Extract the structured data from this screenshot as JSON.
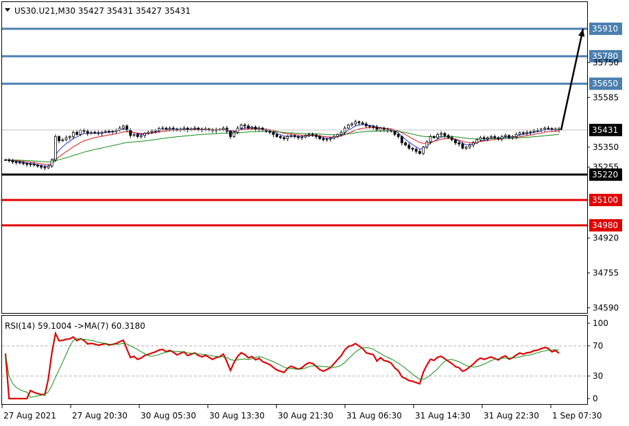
{
  "header": {
    "symbol_line": "US30.U21,M30  35427 35431 35427 35431",
    "dropdown_icon": "triangle-down-icon"
  },
  "chart_data": [
    {
      "type": "candlestick",
      "symbol": "US30.U21",
      "timeframe": "M30",
      "ohlc_last": [
        35427,
        35431,
        35427,
        35431
      ],
      "price_ticks": [
        35750,
        35585,
        35350,
        35255,
        34920,
        34755,
        34590
      ],
      "ylim": [
        34550,
        36020
      ],
      "current_price": 35431,
      "x_tick_labels": [
        "27 Aug 2021",
        "27 Aug 20:30",
        "30 Aug 05:30",
        "30 Aug 13:30",
        "30 Aug 21:30",
        "31 Aug 06:30",
        "31 Aug 14:30",
        "31 Aug 22:30",
        "1 Sep 07:30"
      ],
      "levels": [
        {
          "value": 35910,
          "label": "35910",
          "color": "#4a7fb0"
        },
        {
          "value": 35780,
          "label": "35780",
          "color": "#4a7fb0"
        },
        {
          "value": 35650,
          "label": "35650",
          "color": "#4a7fb0"
        },
        {
          "value": 35220,
          "label": "35220",
          "color": "#000000"
        },
        {
          "value": 35100,
          "label": "35100",
          "color": "#e00000"
        },
        {
          "value": 34980,
          "label": "34980",
          "color": "#e00000"
        }
      ],
      "current_price_label": "35431",
      "arrow": {
        "from_price": 35431,
        "to_price": 35910
      },
      "closes": [
        35290,
        35285,
        35280,
        35278,
        35275,
        35272,
        35268,
        35270,
        35265,
        35260,
        35255,
        35252,
        35260,
        35290,
        35400,
        35380,
        35385,
        35395,
        35400,
        35420,
        35410,
        35430,
        35425,
        35415,
        35420,
        35418,
        35415,
        35420,
        35425,
        35422,
        35425,
        35430,
        35440,
        35450,
        35430,
        35405,
        35410,
        35400,
        35405,
        35415,
        35420,
        35425,
        35430,
        35438,
        35440,
        35435,
        35440,
        35436,
        35430,
        35435,
        35440,
        35432,
        35436,
        35440,
        35435,
        35432,
        35436,
        35432,
        35428,
        35432,
        35434,
        35440,
        35425,
        35400,
        35420,
        35440,
        35455,
        35450,
        35440,
        35445,
        35435,
        35440,
        35430,
        35425,
        35420,
        35410,
        35400,
        35395,
        35390,
        35400,
        35405,
        35400,
        35395,
        35398,
        35405,
        35410,
        35408,
        35400,
        35390,
        35385,
        35388,
        35392,
        35400,
        35410,
        35420,
        35440,
        35455,
        35460,
        35470,
        35465,
        35460,
        35450,
        35448,
        35446,
        35430,
        35440,
        35432,
        35430,
        35425,
        35410,
        35400,
        35370,
        35360,
        35345,
        35340,
        35330,
        35320,
        35350,
        35375,
        35400,
        35395,
        35410,
        35415,
        35405,
        35395,
        35385,
        35370,
        35365,
        35345,
        35350,
        35360,
        35370,
        35385,
        35395,
        35390,
        35395,
        35400,
        35395,
        35390,
        35400,
        35405,
        35395,
        35400,
        35410,
        35418,
        35415,
        35420,
        35422,
        35428,
        35430,
        35435,
        35440,
        35438,
        35432,
        35436,
        35431
      ],
      "rsi_panel": {
        "title": "RSI(14) 59.1004  ->MA(7) 60.3180",
        "ticks": [
          100,
          70,
          30,
          0
        ],
        "ylim": [
          0,
          100
        ],
        "levels": [
          70,
          30
        ]
      }
    }
  ],
  "colors": {
    "candle_up": "#ffffff",
    "candle_outline": "#000000",
    "ma_fast": "#1f2ddd",
    "ma_mid": "#e01010",
    "ma_slow": "#128a12",
    "rsi": "#e00000",
    "rsi_ma": "#128a12",
    "grid_dash": "#b0b0b0"
  }
}
